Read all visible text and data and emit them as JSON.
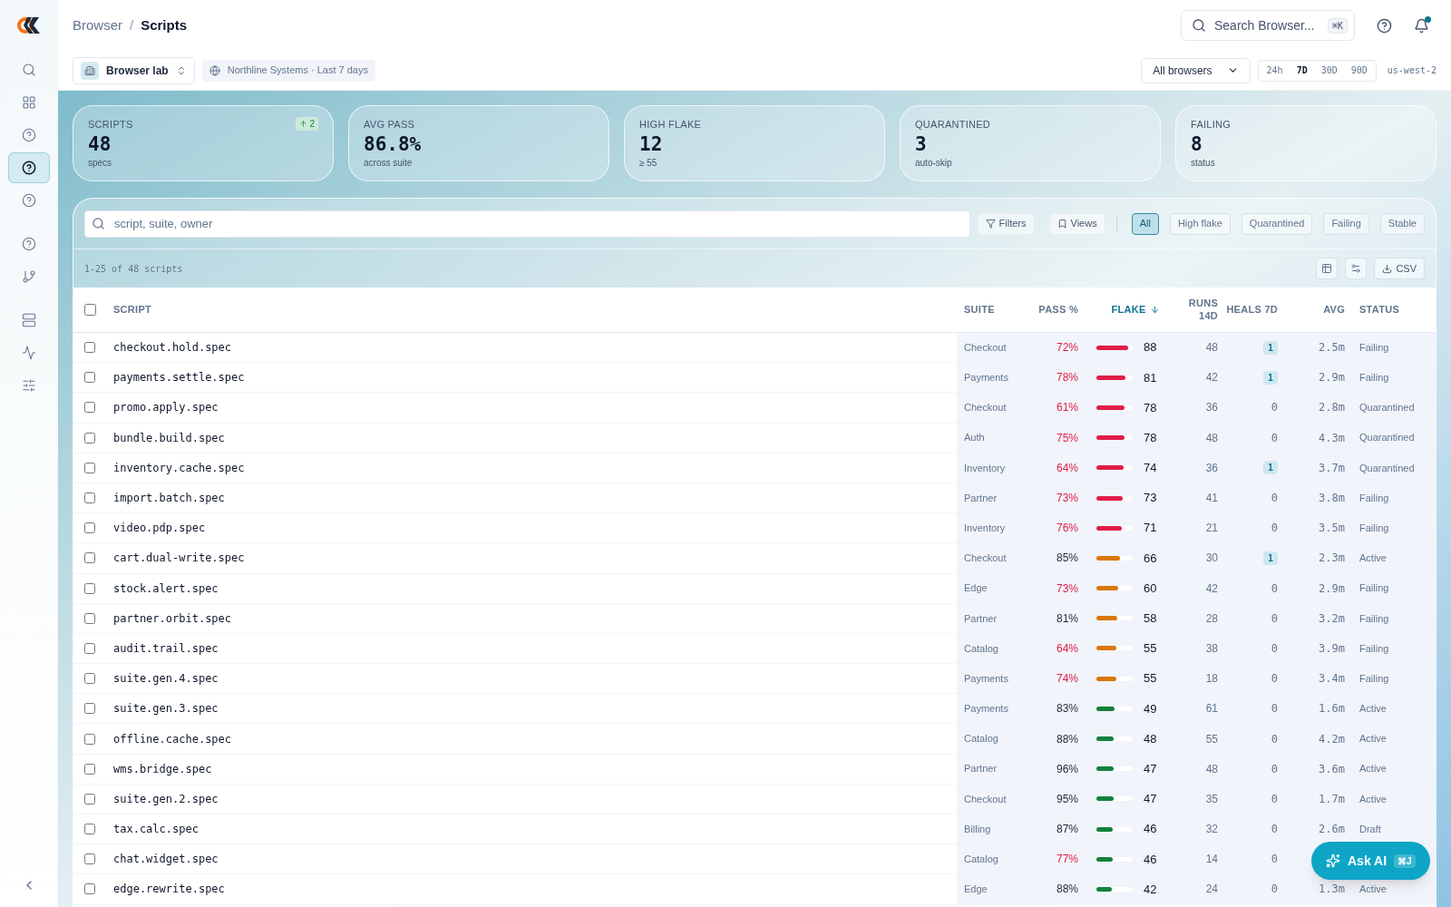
{
  "breadcrumb": {
    "parent": "Browser",
    "separator": "/",
    "current": "Scripts"
  },
  "search": {
    "placeholder": "Search Browser...",
    "shortcut": "⌘K"
  },
  "notifications": {
    "unread": true
  },
  "sidebar": {
    "items": [
      {
        "kind": "search",
        "selected": false
      },
      {
        "kind": "grid",
        "selected": false
      },
      {
        "kind": "help",
        "selected": false
      },
      {
        "kind": "help",
        "selected": true
      },
      {
        "kind": "help",
        "selected": false
      },
      {
        "kind": "help",
        "selected": false
      },
      {
        "kind": "branch",
        "selected": false
      },
      {
        "kind": "server",
        "selected": false
      },
      {
        "kind": "activity",
        "selected": false
      },
      {
        "kind": "sliders",
        "selected": false
      }
    ]
  },
  "workspace": {
    "name": "Browser lab",
    "context": "Northline Systems · Last 7 days"
  },
  "browser_select": {
    "value": "All browsers"
  },
  "time_ranges": [
    {
      "label": "24h",
      "selected": false
    },
    {
      "label": "7D",
      "selected": true
    },
    {
      "label": "30D",
      "selected": false
    },
    {
      "label": "90D",
      "selected": false
    }
  ],
  "region": "us-west-2",
  "kpis": [
    {
      "label": "SCRIPTS",
      "value": "48",
      "sub": "specs",
      "delta": "2"
    },
    {
      "label": "AVG PASS",
      "value": "86.8%",
      "sub": "across suite"
    },
    {
      "label": "HIGH FLAKE",
      "value": "12",
      "sub": "≥ 55"
    },
    {
      "label": "QUARANTINED",
      "value": "3",
      "sub": "auto-skip"
    },
    {
      "label": "FAILING",
      "value": "8",
      "sub": "status"
    }
  ],
  "filter": {
    "placeholder": "script, suite, owner",
    "filters": "Filters",
    "views": "Views"
  },
  "chips": [
    {
      "label": "All",
      "selected": true
    },
    {
      "label": "High flake",
      "selected": false
    },
    {
      "label": "Quarantined",
      "selected": false
    },
    {
      "label": "Failing",
      "selected": false
    },
    {
      "label": "Stable",
      "selected": false
    }
  ],
  "count": "1-25 of 48 scripts",
  "export": "CSV",
  "table": {
    "select_all": {
      "checked": false
    },
    "columns": [
      {
        "label": "SCRIPT",
        "sorted": false
      },
      {
        "label": "SUITE",
        "sorted": false
      },
      {
        "label": "PASS %",
        "sorted": false
      },
      {
        "label": "FLAKE",
        "sorted": true
      },
      {
        "label": "RUNS 14D",
        "sorted": false
      },
      {
        "label": "HEALS 7D",
        "sorted": false
      },
      {
        "label": "AVG",
        "sorted": false
      },
      {
        "label": "STATUS",
        "sorted": false
      }
    ],
    "rows": [
      {
        "checked": false,
        "script": "checkout.hold.spec",
        "suite": "Checkout",
        "pass": "72%",
        "alert": true,
        "level": 0.88,
        "color": "#e11d48",
        "flake": "88",
        "runs": "48",
        "heals": "1",
        "heals_flagged": true,
        "avg": "2.5m",
        "status": "Failing"
      },
      {
        "checked": false,
        "script": "payments.settle.spec",
        "suite": "Payments",
        "pass": "78%",
        "alert": true,
        "level": 0.81,
        "color": "#e11d48",
        "flake": "81",
        "runs": "42",
        "heals": "1",
        "heals_flagged": true,
        "avg": "2.9m",
        "status": "Failing"
      },
      {
        "checked": false,
        "script": "promo.apply.spec",
        "suite": "Checkout",
        "pass": "61%",
        "alert": true,
        "level": 0.78,
        "color": "#e11d48",
        "flake": "78",
        "runs": "36",
        "heals": "0",
        "heals_flagged": false,
        "avg": "2.8m",
        "status": "Quarantined"
      },
      {
        "checked": false,
        "script": "bundle.build.spec",
        "suite": "Auth",
        "pass": "75%",
        "alert": true,
        "level": 0.78,
        "color": "#e11d48",
        "flake": "78",
        "runs": "48",
        "heals": "0",
        "heals_flagged": false,
        "avg": "4.3m",
        "status": "Quarantined"
      },
      {
        "checked": false,
        "script": "inventory.cache.spec",
        "suite": "Inventory",
        "pass": "64%",
        "alert": true,
        "level": 0.74,
        "color": "#e11d48",
        "flake": "74",
        "runs": "36",
        "heals": "1",
        "heals_flagged": true,
        "avg": "3.7m",
        "status": "Quarantined"
      },
      {
        "checked": false,
        "script": "import.batch.spec",
        "suite": "Partner",
        "pass": "73%",
        "alert": true,
        "level": 0.73,
        "color": "#e11d48",
        "flake": "73",
        "runs": "41",
        "heals": "0",
        "heals_flagged": false,
        "avg": "3.8m",
        "status": "Failing"
      },
      {
        "checked": false,
        "script": "video.pdp.spec",
        "suite": "Inventory",
        "pass": "76%",
        "alert": true,
        "level": 0.71,
        "color": "#e11d48",
        "flake": "71",
        "runs": "21",
        "heals": "0",
        "heals_flagged": false,
        "avg": "3.5m",
        "status": "Failing"
      },
      {
        "checked": false,
        "script": "cart.dual-write.spec",
        "suite": "Checkout",
        "pass": "85%",
        "alert": false,
        "level": 0.66,
        "color": "#d97706",
        "flake": "66",
        "runs": "30",
        "heals": "1",
        "heals_flagged": true,
        "avg": "2.3m",
        "status": "Active"
      },
      {
        "checked": false,
        "script": "stock.alert.spec",
        "suite": "Edge",
        "pass": "73%",
        "alert": true,
        "level": 0.6,
        "color": "#d97706",
        "flake": "60",
        "runs": "42",
        "heals": "0",
        "heals_flagged": false,
        "avg": "2.9m",
        "status": "Failing"
      },
      {
        "checked": false,
        "script": "partner.orbit.spec",
        "suite": "Partner",
        "pass": "81%",
        "alert": false,
        "level": 0.58,
        "color": "#d97706",
        "flake": "58",
        "runs": "28",
        "heals": "0",
        "heals_flagged": false,
        "avg": "3.2m",
        "status": "Failing"
      },
      {
        "checked": false,
        "script": "audit.trail.spec",
        "suite": "Catalog",
        "pass": "64%",
        "alert": true,
        "level": 0.55,
        "color": "#d97706",
        "flake": "55",
        "runs": "38",
        "heals": "0",
        "heals_flagged": false,
        "avg": "3.9m",
        "status": "Failing"
      },
      {
        "checked": false,
        "script": "suite.gen.4.spec",
        "suite": "Payments",
        "pass": "74%",
        "alert": true,
        "level": 0.55,
        "color": "#d97706",
        "flake": "55",
        "runs": "18",
        "heals": "0",
        "heals_flagged": false,
        "avg": "3.4m",
        "status": "Failing"
      },
      {
        "checked": false,
        "script": "suite.gen.3.spec",
        "suite": "Payments",
        "pass": "83%",
        "alert": false,
        "level": 0.49,
        "color": "#15803d",
        "flake": "49",
        "runs": "61",
        "heals": "0",
        "heals_flagged": false,
        "avg": "1.6m",
        "status": "Active"
      },
      {
        "checked": false,
        "script": "offline.cache.spec",
        "suite": "Catalog",
        "pass": "88%",
        "alert": false,
        "level": 0.48,
        "color": "#15803d",
        "flake": "48",
        "runs": "55",
        "heals": "0",
        "heals_flagged": false,
        "avg": "4.2m",
        "status": "Active"
      },
      {
        "checked": false,
        "script": "wms.bridge.spec",
        "suite": "Partner",
        "pass": "96%",
        "alert": false,
        "level": 0.47,
        "color": "#15803d",
        "flake": "47",
        "runs": "48",
        "heals": "0",
        "heals_flagged": false,
        "avg": "3.6m",
        "status": "Active"
      },
      {
        "checked": false,
        "script": "suite.gen.2.spec",
        "suite": "Checkout",
        "pass": "95%",
        "alert": false,
        "level": 0.47,
        "color": "#15803d",
        "flake": "47",
        "runs": "35",
        "heals": "0",
        "heals_flagged": false,
        "avg": "1.7m",
        "status": "Active"
      },
      {
        "checked": false,
        "script": "tax.calc.spec",
        "suite": "Billing",
        "pass": "87%",
        "alert": false,
        "level": 0.46,
        "color": "#15803d",
        "flake": "46",
        "runs": "32",
        "heals": "0",
        "heals_flagged": false,
        "avg": "2.6m",
        "status": "Draft"
      },
      {
        "checked": false,
        "script": "chat.widget.spec",
        "suite": "Catalog",
        "pass": "77%",
        "alert": true,
        "level": 0.46,
        "color": "#15803d",
        "flake": "46",
        "runs": "14",
        "heals": "0",
        "heals_flagged": false
      },
      {
        "checked": false,
        "script": "edge.rewrite.spec",
        "suite": "Edge",
        "pass": "88%",
        "alert": false,
        "level": 0.42,
        "color": "#15803d",
        "flake": "42",
        "runs": "24",
        "heals": "0",
        "heals_flagged": false,
        "avg": "1.3m",
        "status": "Active"
      }
    ]
  },
  "ask_ai": {
    "label": "Ask AI",
    "shortcut": "⌘J"
  }
}
